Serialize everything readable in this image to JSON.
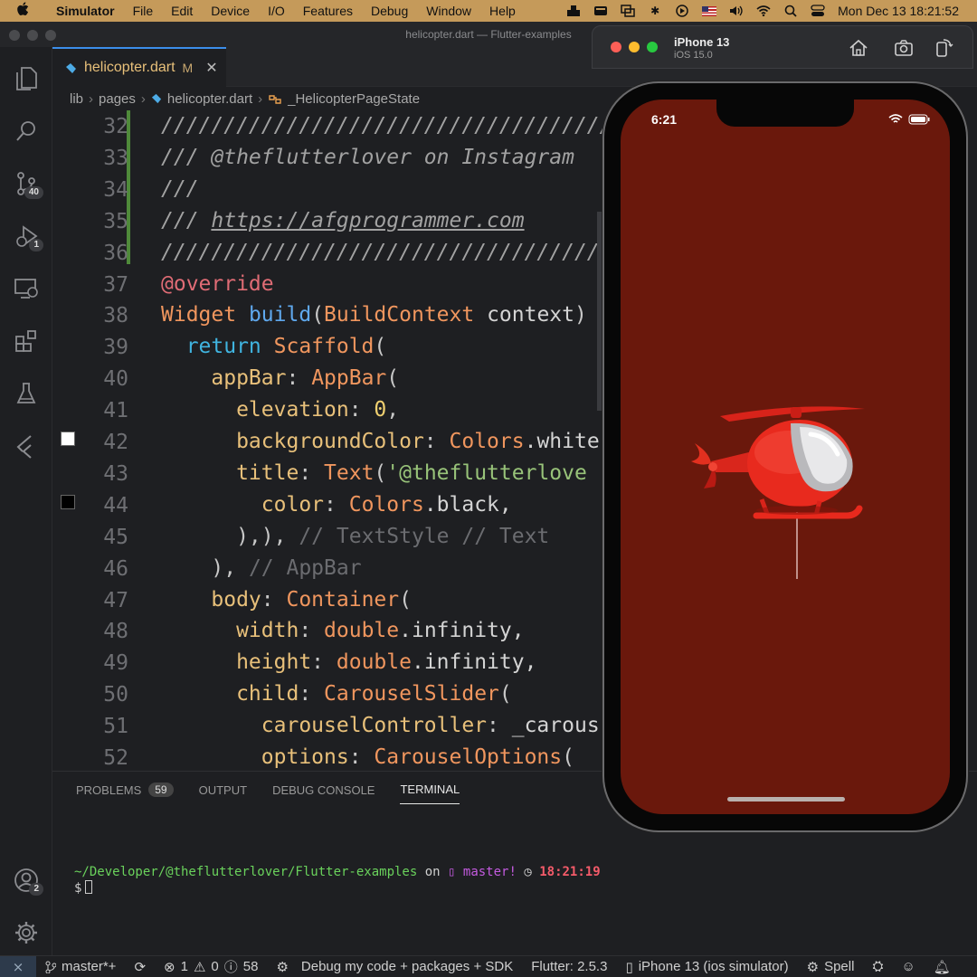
{
  "menubar": {
    "app": "Simulator",
    "items": [
      "File",
      "Edit",
      "Device",
      "I/O",
      "Features",
      "Debug",
      "Window",
      "Help"
    ],
    "clock": "Mon Dec 13  18:21:52"
  },
  "vscode": {
    "window_title": "helicopter.dart — Flutter-examples",
    "tab": {
      "label": "helicopter.dart",
      "modified": "M"
    },
    "breadcrumb": [
      "lib",
      "pages",
      "helicopter.dart",
      "_HelicopterPageState"
    ],
    "activity_badges": {
      "source_control": "40",
      "debug": "1",
      "accounts": "2"
    },
    "code_lines": [
      {
        "n": "32",
        "segs": [
          {
            "t": "////////////////////////////////////",
            "c": "c-com"
          }
        ]
      },
      {
        "n": "33",
        "segs": [
          {
            "t": "/// @theflutterlover on Instagram",
            "c": "c-com"
          }
        ]
      },
      {
        "n": "34",
        "segs": [
          {
            "t": "///",
            "c": "c-com"
          }
        ]
      },
      {
        "n": "35",
        "segs": [
          {
            "t": "/// ",
            "c": "c-com"
          },
          {
            "t": "https://afgprogrammer.com",
            "c": "c-link"
          }
        ]
      },
      {
        "n": "36",
        "segs": [
          {
            "t": "////////////////////////////////////",
            "c": "c-com"
          }
        ]
      },
      {
        "n": "37",
        "segs": [
          {
            "t": "@override",
            "c": "c-anno"
          }
        ]
      },
      {
        "n": "38",
        "segs": [
          {
            "t": "Widget ",
            "c": "c-type"
          },
          {
            "t": "build",
            "c": "c-fn"
          },
          {
            "t": "(",
            "c": "c-punct"
          },
          {
            "t": "BuildContext ",
            "c": "c-type"
          },
          {
            "t": "context",
            "c": "c-var"
          },
          {
            "t": ")",
            "c": "c-punct"
          }
        ]
      },
      {
        "n": "39",
        "segs": [
          {
            "t": "  return ",
            "c": "c-kw"
          },
          {
            "t": "Scaffold",
            "c": "c-type"
          },
          {
            "t": "(",
            "c": "c-punct"
          }
        ]
      },
      {
        "n": "40",
        "segs": [
          {
            "t": "    appBar",
            "c": "c-prop"
          },
          {
            "t": ": ",
            "c": "c-punct"
          },
          {
            "t": "AppBar",
            "c": "c-type"
          },
          {
            "t": "(",
            "c": "c-punct"
          }
        ]
      },
      {
        "n": "41",
        "segs": [
          {
            "t": "      elevation",
            "c": "c-prop"
          },
          {
            "t": ": ",
            "c": "c-punct"
          },
          {
            "t": "0",
            "c": "c-num"
          },
          {
            "t": ",",
            "c": "c-punct"
          }
        ]
      },
      {
        "n": "42",
        "segs": [
          {
            "t": "      backgroundColor",
            "c": "c-prop"
          },
          {
            "t": ": ",
            "c": "c-punct"
          },
          {
            "t": "Colors",
            "c": "c-type"
          },
          {
            "t": ".white",
            "c": "c-var"
          }
        ]
      },
      {
        "n": "43",
        "segs": [
          {
            "t": "      title",
            "c": "c-prop"
          },
          {
            "t": ": ",
            "c": "c-punct"
          },
          {
            "t": "Text",
            "c": "c-type"
          },
          {
            "t": "(",
            "c": "c-punct"
          },
          {
            "t": "'@theflutterlove",
            "c": "c-str"
          }
        ]
      },
      {
        "n": "44",
        "segs": [
          {
            "t": "        color",
            "c": "c-prop"
          },
          {
            "t": ": ",
            "c": "c-punct"
          },
          {
            "t": "Colors",
            "c": "c-type"
          },
          {
            "t": ".black,",
            "c": "c-var"
          }
        ]
      },
      {
        "n": "45",
        "segs": [
          {
            "t": "      ),),",
            "c": "c-punct"
          },
          {
            "t": " // TextStyle // Text",
            "c": "c-dim"
          }
        ]
      },
      {
        "n": "46",
        "segs": [
          {
            "t": "    ),",
            "c": "c-punct"
          },
          {
            "t": " // AppBar",
            "c": "c-dim"
          }
        ]
      },
      {
        "n": "47",
        "segs": [
          {
            "t": "    body",
            "c": "c-prop"
          },
          {
            "t": ": ",
            "c": "c-punct"
          },
          {
            "t": "Container",
            "c": "c-type"
          },
          {
            "t": "(",
            "c": "c-punct"
          }
        ]
      },
      {
        "n": "48",
        "segs": [
          {
            "t": "      width",
            "c": "c-prop"
          },
          {
            "t": ": ",
            "c": "c-punct"
          },
          {
            "t": "double",
            "c": "c-type"
          },
          {
            "t": ".infinity,",
            "c": "c-var"
          }
        ]
      },
      {
        "n": "49",
        "segs": [
          {
            "t": "      height",
            "c": "c-prop"
          },
          {
            "t": ": ",
            "c": "c-punct"
          },
          {
            "t": "double",
            "c": "c-type"
          },
          {
            "t": ".infinity,",
            "c": "c-var"
          }
        ]
      },
      {
        "n": "50",
        "segs": [
          {
            "t": "      child",
            "c": "c-prop"
          },
          {
            "t": ": ",
            "c": "c-punct"
          },
          {
            "t": "CarouselSlider",
            "c": "c-type"
          },
          {
            "t": "(",
            "c": "c-punct"
          }
        ]
      },
      {
        "n": "51",
        "segs": [
          {
            "t": "        carouselController",
            "c": "c-prop"
          },
          {
            "t": ": ",
            "c": "c-punct"
          },
          {
            "t": "_carous",
            "c": "c-var"
          }
        ]
      },
      {
        "n": "52",
        "segs": [
          {
            "t": "        options",
            "c": "c-prop"
          },
          {
            "t": ": ",
            "c": "c-punct"
          },
          {
            "t": "CarouselOptions",
            "c": "c-type"
          },
          {
            "t": "(",
            "c": "c-punct"
          }
        ]
      }
    ],
    "panel": {
      "tabs": [
        {
          "label": "PROBLEMS",
          "count": "59"
        },
        {
          "label": "OUTPUT"
        },
        {
          "label": "DEBUG CONSOLE"
        },
        {
          "label": "TERMINAL",
          "active": true
        }
      ],
      "terminal": {
        "path": "~/Developer/@theflutterlover/Flutter-examples",
        "on": "on",
        "branch": " master!",
        "time": "18:21:19",
        "prompt": "$"
      }
    },
    "statusbar": {
      "branch": "master*+",
      "errors": "1",
      "warnings": "0",
      "infos": "58",
      "debug": "Debug my code + packages + SDK",
      "flutter": "Flutter: 2.5.3",
      "device": "iPhone 13 (ios simulator)",
      "spell": "Spell"
    }
  },
  "simulator": {
    "device": "iPhone 13",
    "os": "iOS 15.0",
    "phone_time": "6:21",
    "screen_color": "#6a180c"
  }
}
